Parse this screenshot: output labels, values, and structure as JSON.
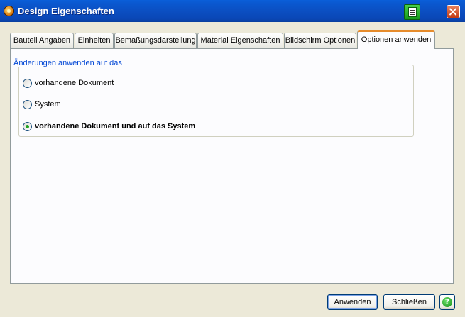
{
  "window": {
    "title": "Design Eigenschaften"
  },
  "tabs": [
    {
      "label": "Bauteil Angaben"
    },
    {
      "label": "Einheiten"
    },
    {
      "label": "Bemaßungsdarstellung"
    },
    {
      "label": "Material Eigenschaften"
    },
    {
      "label": "Bildschirm Optionen"
    },
    {
      "label": "Optionen anwenden",
      "active": true
    }
  ],
  "group": {
    "label": "Änderungen anwenden auf das",
    "options": [
      {
        "label": "vorhandene Dokument",
        "selected": false
      },
      {
        "label": "System",
        "selected": false
      },
      {
        "label": "vorhandene Dokument und auf das System",
        "selected": true
      }
    ]
  },
  "buttons": {
    "apply": "Anwenden",
    "close": "Schließen",
    "help": "?"
  },
  "icons": {
    "app": "app-logo-icon",
    "print": "print-icon",
    "close": "close-icon",
    "help": "help-icon"
  },
  "colors": {
    "titlebar": "#0a58d0",
    "active_tab_accent": "#e68b2c",
    "group_label": "#0046d5",
    "radio_checked": "#21a121"
  }
}
